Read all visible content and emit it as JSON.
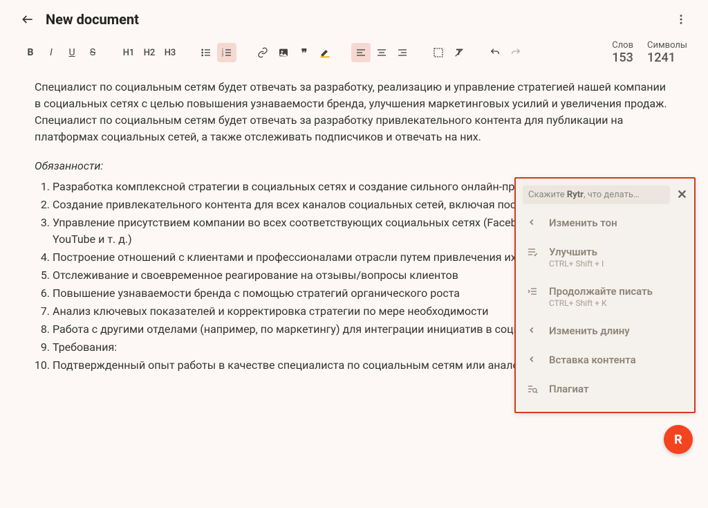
{
  "header": {
    "title": "New document"
  },
  "counters": {
    "words_label": "Слов",
    "words_value": "153",
    "chars_label": "Символы",
    "chars_value": "1241"
  },
  "toolbar": {
    "bold": "B",
    "italic": "I",
    "underline": "U",
    "strike": "S",
    "h1": "H1",
    "h2": "H2",
    "h3": "H3"
  },
  "content": {
    "intro": "Специалист по социальным сетям будет отвечать за разработку, реализацию и управление стратегией нашей компании в социальных сетях с целью повышения узнаваемости бренда, улучшения маркетинговых усилий и увеличения продаж. Специалист по социальным сетям будет отвечать за разработку привлекательного контента для публикации на платформах социальных сетей, а также отслеживать подписчиков и отвечать на них.",
    "section_title": "Обязанности:",
    "items": [
      "Разработка комплексной стратегии в социальных сетях и создание сильного онлайн-присутствия.",
      "Создание привлекательного контента для всех каналов социальных сетей, включая посты, изображения и видео.",
      "Управление присутствием компании во всех соответствующих социальных сетях (Facebook, Twitter, Instagram, YouTube и т. д.)",
      "Построение отношений с клиентами и профессионалами отрасли путем привлечения их через социальные сети",
      "Отслеживание и своевременное реагирование на отзывы/вопросы клиентов",
      "Повышение узнаваемости бренда с помощью стратегий органического роста",
      "Анализ ключевых показателей и корректировка стратегии по мере необходимости",
      "Работа с другими отделами (например, по маркетингу) для интеграции инициатив в социальных сетях",
      "Требования:",
      "Подтвержденный опыт работы в качестве специалиста по социальным сетям или аналогичной должности"
    ]
  },
  "context_menu": {
    "placeholder_pre": "Скажите ",
    "placeholder_bold": "Rytr",
    "placeholder_post": ", что делать…",
    "items": [
      {
        "icon": "chevron-left",
        "label": "Изменить тон",
        "shortcut": ""
      },
      {
        "icon": "improve",
        "label": "Улучшить",
        "shortcut": "CTRL+ Shift + I"
      },
      {
        "icon": "continue",
        "label": "Продолжайте писать",
        "shortcut": "CTRL+ Shift + K"
      },
      {
        "icon": "chevron-left",
        "label": "Изменить длину",
        "shortcut": ""
      },
      {
        "icon": "chevron-left",
        "label": "Вставка контента",
        "shortcut": ""
      },
      {
        "icon": "plagiarism",
        "label": "Плагиат",
        "shortcut": ""
      }
    ]
  },
  "fab": {
    "label": "R"
  }
}
